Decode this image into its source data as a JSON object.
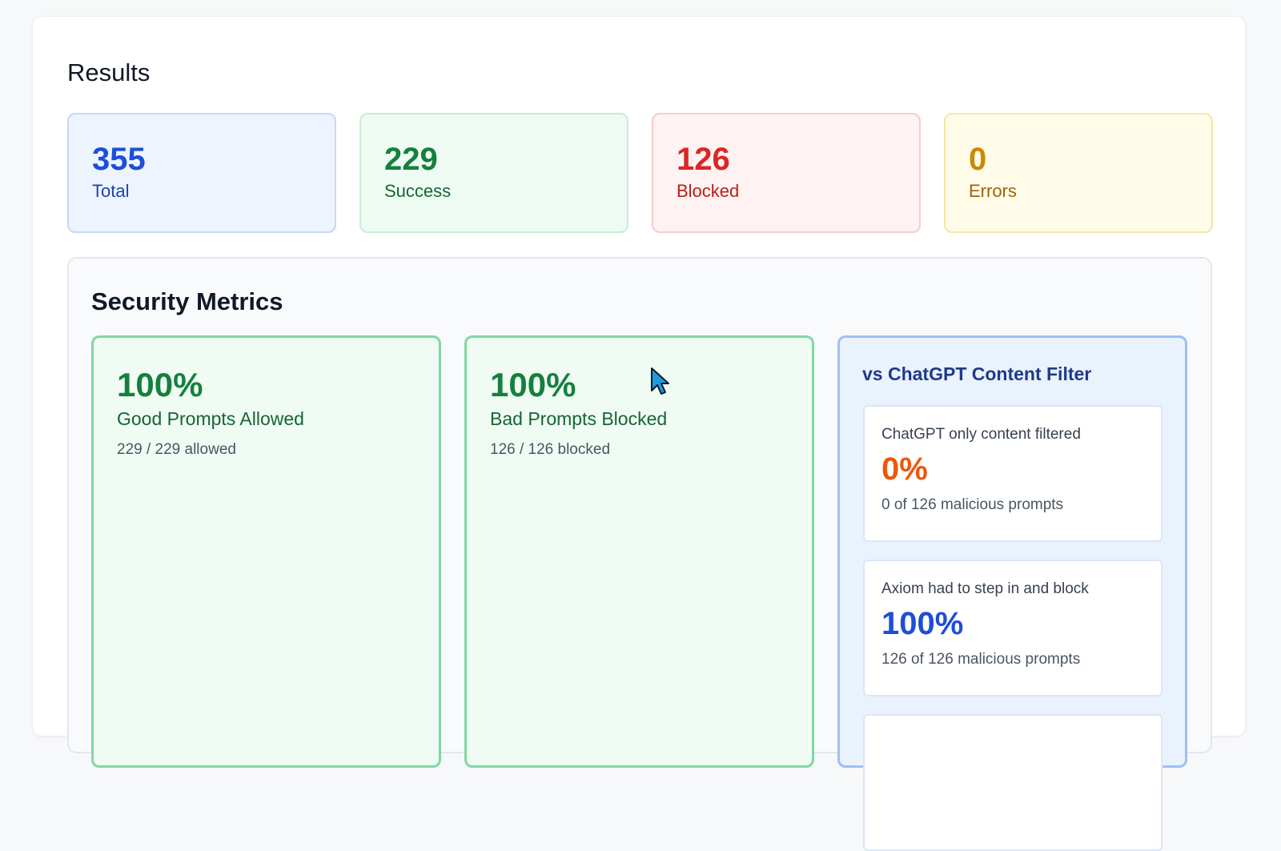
{
  "results": {
    "title": "Results",
    "stats": [
      {
        "value": "355",
        "label": "Total"
      },
      {
        "value": "229",
        "label": "Success"
      },
      {
        "value": "126",
        "label": "Blocked"
      },
      {
        "value": "0",
        "label": "Errors"
      }
    ]
  },
  "security_metrics": {
    "title": "Security Metrics",
    "good_prompts": {
      "value": "100%",
      "label": "Good Prompts Allowed",
      "sub": "229 / 229 allowed"
    },
    "bad_prompts": {
      "value": "100%",
      "label": "Bad Prompts Blocked",
      "sub": "126 / 126 blocked"
    },
    "comparison": {
      "title": "vs ChatGPT Content Filter",
      "items": [
        {
          "label": "ChatGPT only content filtered",
          "value": "0%",
          "sub": "0 of 126 malicious prompts"
        },
        {
          "label": "Axiom had to step in and block",
          "value": "100%",
          "sub": "126 of 126 malicious prompts"
        }
      ]
    }
  },
  "colors": {
    "total": "#1d4ed8",
    "success": "#15803d",
    "blocked": "#dc2626",
    "errors": "#ca8a04",
    "chatgpt_filtered": "#ea580c",
    "axiom_blocked": "#1d4ed8"
  },
  "icons": {
    "cursor": "mouse-pointer-icon"
  }
}
